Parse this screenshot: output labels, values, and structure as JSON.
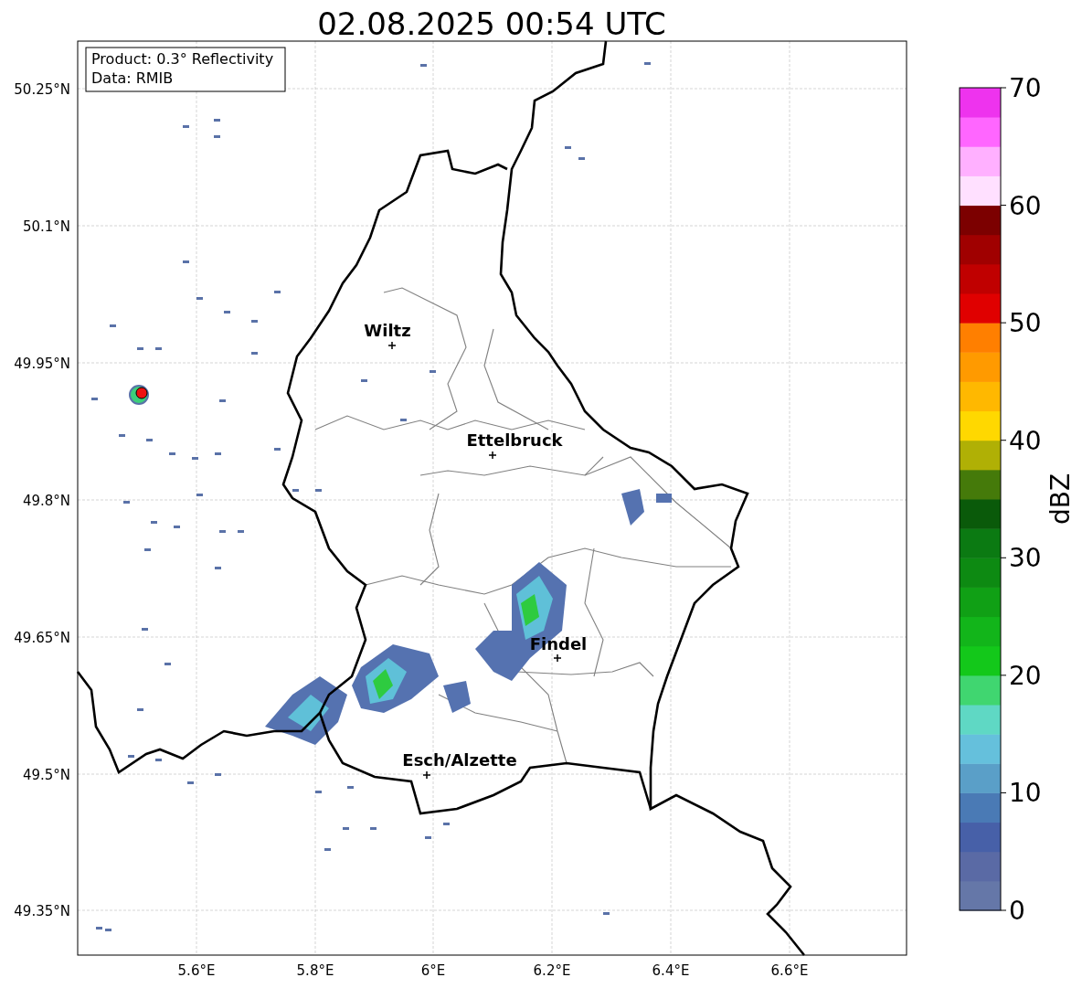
{
  "title": "02.08.2025 00:54 UTC",
  "info_box": [
    "Product: 0.3° Reflectivity",
    "Data: RMIB"
  ],
  "map": {
    "lat_ticks": [
      "50.25°N",
      "50.1°N",
      "49.95°N",
      "49.8°N",
      "49.65°N",
      "49.5°N",
      "49.35°N"
    ],
    "lon_ticks": [
      "5.6°E",
      "5.8°E",
      "6°E",
      "6.2°E",
      "6.4°E",
      "6.6°E"
    ],
    "cities": [
      "Wiltz",
      "Ettelbruck",
      "Findel",
      "Esch/Alzette"
    ]
  },
  "colorbar": {
    "label": "dBZ",
    "ticks": [
      "70",
      "60",
      "50",
      "40",
      "30",
      "20",
      "10",
      "0"
    ]
  }
}
